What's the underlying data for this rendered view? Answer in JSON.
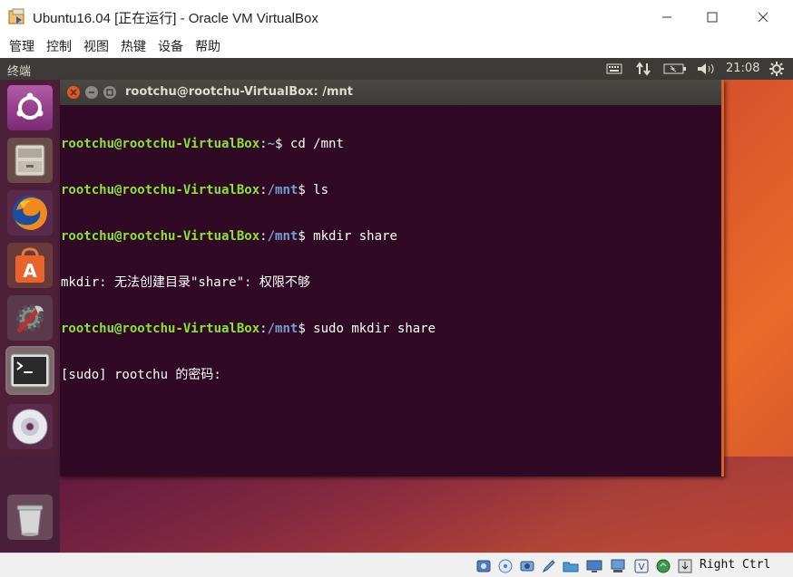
{
  "window": {
    "title": "Ubuntu16.04 [正在运行] - Oracle VM VirtualBox"
  },
  "menu": [
    "管理",
    "控制",
    "视图",
    "热键",
    "设备",
    "帮助"
  ],
  "panel": {
    "app_name": "终端",
    "time": "21:08"
  },
  "launcher": {
    "items": [
      "ubuntu-dash",
      "files",
      "firefox",
      "software-center",
      "system-settings",
      "terminal",
      "dvd",
      "trash"
    ],
    "active": "terminal"
  },
  "terminal": {
    "title": "rootchu@rootchu-VirtualBox: /mnt",
    "lines": [
      {
        "user": "rootchu@rootchu-VirtualBox",
        "path": "~",
        "cmd": " cd /mnt"
      },
      {
        "user": "rootchu@rootchu-VirtualBox",
        "path": "/mnt",
        "cmd": " ls"
      },
      {
        "user": "rootchu@rootchu-VirtualBox",
        "path": "/mnt",
        "cmd": " mkdir share"
      },
      {
        "text": "mkdir: 无法创建目录\"share\": 权限不够"
      },
      {
        "user": "rootchu@rootchu-VirtualBox",
        "path": "/mnt",
        "cmd": " sudo mkdir share"
      },
      {
        "text": "[sudo] rootchu 的密码:"
      }
    ]
  },
  "statusbar": {
    "host_key": "Right Ctrl"
  }
}
